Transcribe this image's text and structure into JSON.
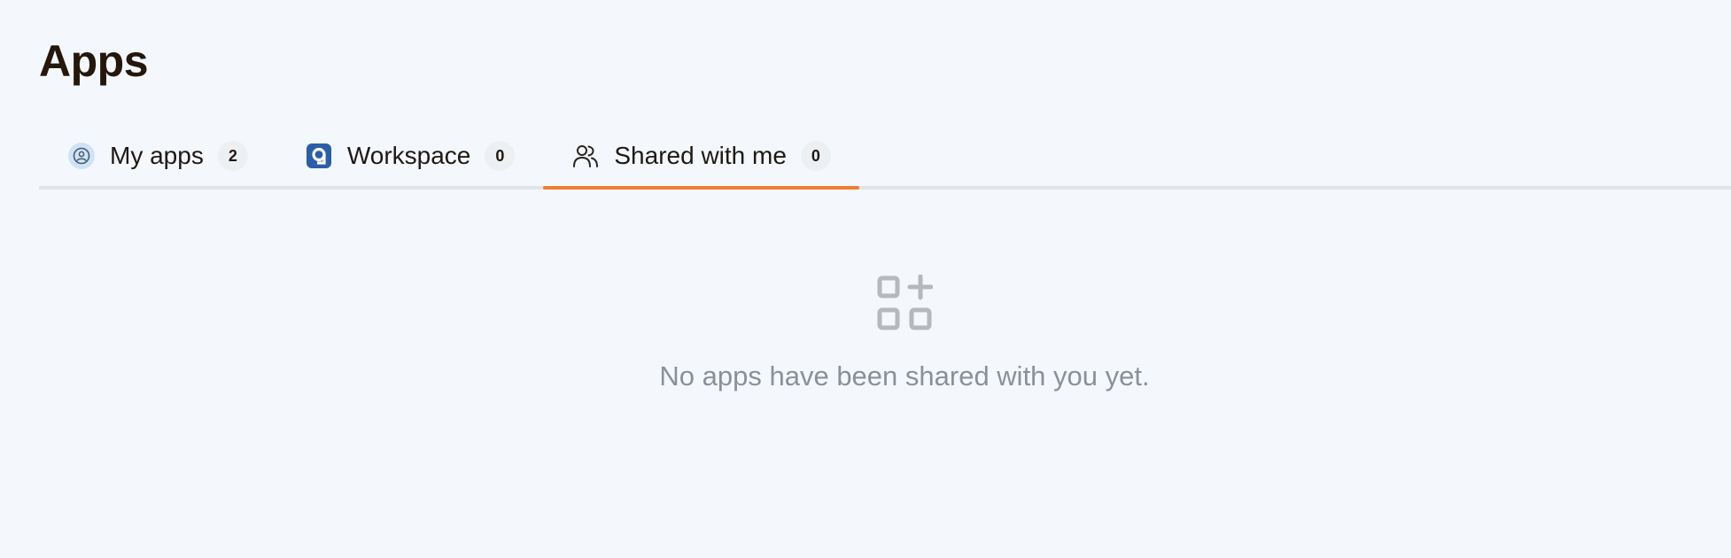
{
  "page": {
    "title": "Apps"
  },
  "tabs": [
    {
      "label": "My apps",
      "count": "2",
      "icon": "user-circle-icon"
    },
    {
      "label": "Workspace",
      "count": "0",
      "icon": "workspace-logo-icon"
    },
    {
      "label": "Shared with me",
      "count": "0",
      "icon": "users-icon",
      "active": true
    }
  ],
  "empty_state": {
    "icon": "apps-add-icon",
    "message": "No apps have been shared with you yet."
  },
  "colors": {
    "accent": "#ef7d32",
    "background": "#f4f8fc",
    "muted_text": "#8b9097",
    "badge_bg": "#edf0f3"
  }
}
